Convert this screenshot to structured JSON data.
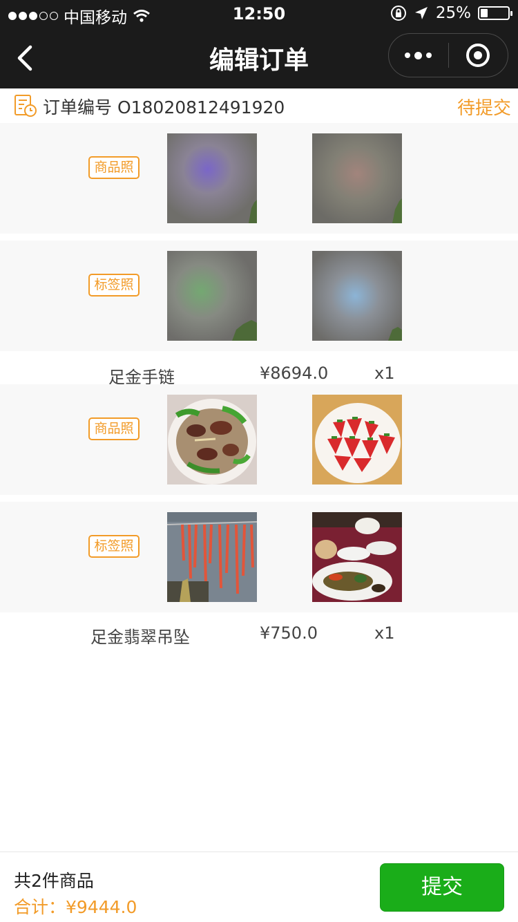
{
  "status_bar": {
    "carrier": "中国移动",
    "time": "12:50",
    "battery": "25%",
    "battery_level": 0.25
  },
  "nav": {
    "title": "编辑订单",
    "back_icon": "chevron-left-icon",
    "more_icon": "more-dots-icon",
    "close_icon": "target-circle-icon"
  },
  "order": {
    "number_text": "订单编号 O18020812491920",
    "status": "待提交",
    "icon": "order-document-icon"
  },
  "items": [
    {
      "product_photo_tag": "商品照",
      "label_photo_tag": "标签照",
      "name": "足金手链",
      "price": "¥8694.0",
      "quantity": "x1",
      "product_photos": [
        "blurred-photo-purple",
        "blurred-photo-red"
      ],
      "label_photos": [
        "blurred-photo-green",
        "blurred-photo-blue"
      ]
    },
    {
      "product_photo_tag": "商品照",
      "label_photo_tag": "标签照",
      "name": "足金翡翠吊坠",
      "price": "¥750.0",
      "quantity": "x1",
      "product_photos": [
        "food-dish-photo",
        "strawberry-bowl-photo"
      ],
      "label_photos": [
        "hanging-sausage-photo",
        "dining-table-photo"
      ]
    }
  ],
  "footer": {
    "count_text": "共2件商品",
    "total_text": "合计：¥9444.0",
    "submit_label": "提交"
  },
  "colors": {
    "accent": "#f29b28",
    "primary_button": "#1aad19",
    "nav_background": "#1b1b1b",
    "row_background": "#f8f8f8"
  }
}
